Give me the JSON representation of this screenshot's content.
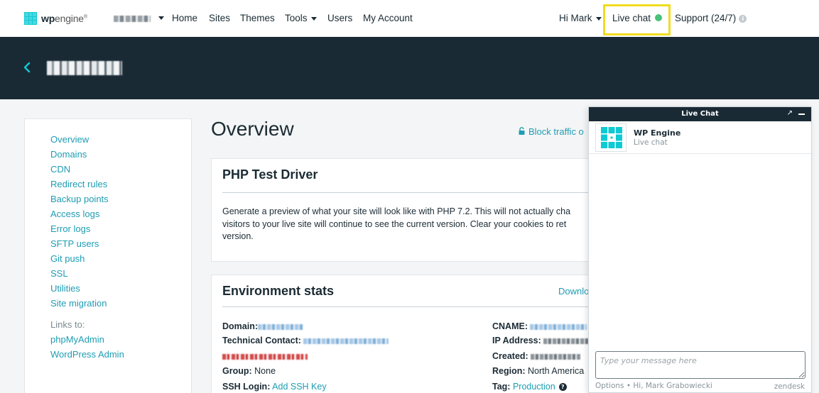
{
  "topnav": {
    "logo_bold": "wp",
    "logo_rest": "engine",
    "logo_mark": "®",
    "items": [
      "Home",
      "Sites",
      "Themes",
      "Tools",
      "Users",
      "My Account"
    ],
    "greeting": "Hi Mark",
    "live_chat": "Live chat",
    "support": "Support (24/7)",
    "highlight_color": "#f1dc1e",
    "status_color": "#48c378"
  },
  "site_header": {
    "background": "#1a2a35"
  },
  "sidebar": {
    "items": [
      "Overview",
      "Domains",
      "CDN",
      "Redirect rules",
      "Backup points",
      "Access logs",
      "Error logs",
      "SFTP users",
      "Git push",
      "SSL",
      "Utilities",
      "Site migration"
    ],
    "links_label": "Links to:",
    "links": [
      "phpMyAdmin",
      "WordPress Admin"
    ]
  },
  "main": {
    "title": "Overview",
    "block_traffic": "Block traffic o",
    "php_card": {
      "title": "PHP Test Driver",
      "lines": [
        "Generate a preview of what your site will look like with PHP 7.2. This will not actually cha",
        "visitors to your live site will continue to see the current version. Clear your cookies to ret",
        "version."
      ]
    },
    "env_card": {
      "title": "Environment stats",
      "download": "Downlo",
      "domain_label": "Domain:",
      "technical_contact_label": "Technical Contact:",
      "group_label": "Group:",
      "group_value": "None",
      "ssh_label": "SSH Login:",
      "ssh_value": "Add SSH Key",
      "cname_label": "CNAME:",
      "ip_label": "IP Address:",
      "created_label": "Created:",
      "region_label": "Region:",
      "region_value": "North America",
      "tag_label": "Tag:",
      "tag_value": "Production"
    }
  },
  "chat": {
    "header": "Live Chat",
    "popout": "↗",
    "agent_name": "WP Engine",
    "agent_status": "Live chat",
    "input_placeholder": "Type your message here",
    "footer": "Options • Hi, Mark Grabowiecki",
    "brand": "zendesk"
  }
}
